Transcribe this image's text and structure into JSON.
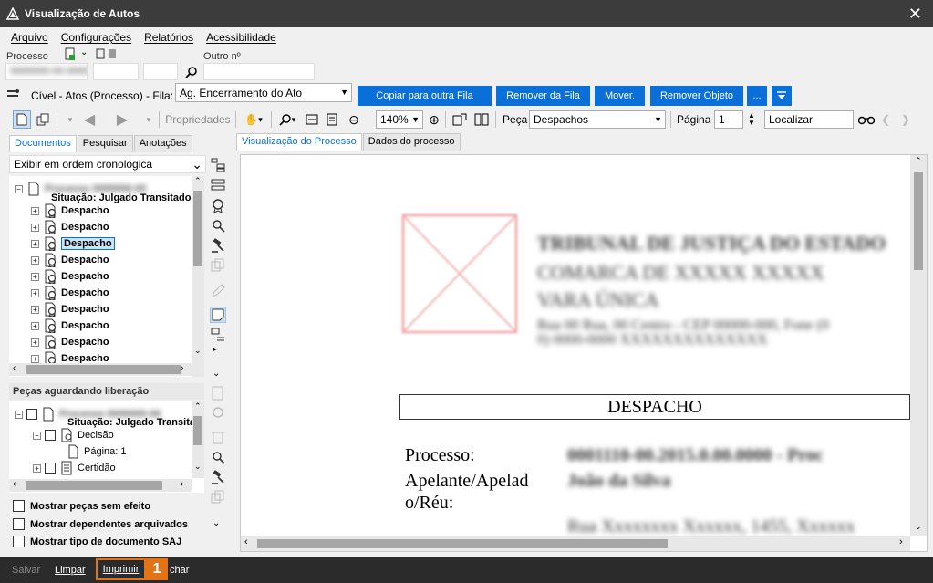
{
  "window": {
    "title": "Visualização de Autos"
  },
  "menu": [
    "Arquivo",
    "Configurações",
    "Relatórios",
    "Acessibilidade"
  ],
  "processo": {
    "label": "Processo",
    "outro_label": "Outro nº",
    "number_redacted": "0000000-00.0000.0.00.0000"
  },
  "fila": {
    "context": "Cível - Atos (Processo) - Fila:",
    "selected": "Ag. Encerramento do Ato",
    "buttons": [
      "Copiar para outra Fila",
      "Remover da Fila",
      "Mover.",
      "Remover Objeto",
      "..."
    ]
  },
  "toolbar": {
    "propriedades": "Propriedades",
    "zoom": "140%",
    "peca_label": "Peça",
    "peca_value": "Despachos",
    "pagina_label": "Página",
    "pagina_value": "1",
    "localizar_placeholder": "Localizar"
  },
  "left_tabs": [
    "Documentos",
    "Pesquisar",
    "Anotações"
  ],
  "ordem": "Exibir em ordem cronológica",
  "tree": {
    "root_redacted": "Processo 0000000-00",
    "situacao": "Situação: Julgado Transitado",
    "items": [
      "Despacho",
      "Despacho",
      "Despacho",
      "Despacho",
      "Despacho",
      "Despacho",
      "Despacho",
      "Despacho",
      "Despacho",
      "Despacho",
      "Despacho"
    ]
  },
  "pecas": {
    "header": "Peças aguardando liberação",
    "situacao": "Situação: Julgado Transita",
    "decisao": "Decisão",
    "pagina": "Página: 1",
    "certidao": "Certidão"
  },
  "checks": [
    "Mostrar peças sem efeito",
    "Mostrar dependentes arquivados",
    "Mostrar tipo de documento SAJ"
  ],
  "right_tabs": [
    "Visualização do Processo",
    "Dados do processo"
  ],
  "document": {
    "header_lines": [
      "TRIBUNAL DE JUSTIÇA DO ESTADO",
      "COMARCA DE XXXXX XXXXX",
      "VARA ÚNICA",
      "Rua 00 Rua, 00 Centro - CEP 00000-000, Fone (0",
      "0) 0000-0000 XXXXXXXXXXXXXX"
    ],
    "title": "DESPACHO",
    "processo_label": "Processo:",
    "apelante_label": "Apelante/Apelad",
    "reu_label": "o/Réu:",
    "processo_value_redacted": "0001110-00.2015.0.00.0000 - Proc",
    "apelante_value_redacted": "João da Silva",
    "address_redacted": "Rua Xxxxxxxx Xxxxxx, 1455, Xxxxxx"
  },
  "bottom": {
    "salvar": "Salvar",
    "limpar": "Limpar",
    "imprimir": "Imprimir",
    "fechar_partial": "char",
    "badge": "1"
  },
  "colors": {
    "accent": "#0a6fd6",
    "highlight": "#e27316",
    "titlebar": "#3c3c3c"
  }
}
